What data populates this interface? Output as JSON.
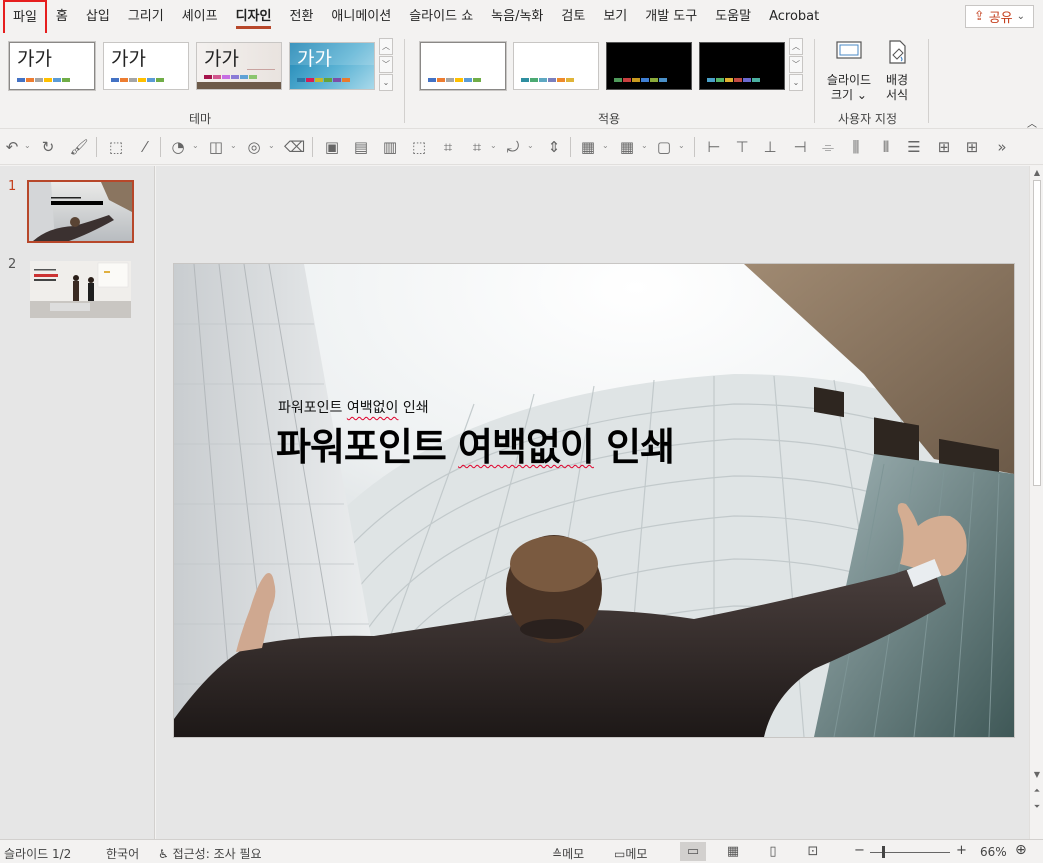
{
  "tabs": {
    "file": "파일",
    "home": "홈",
    "insert": "삽입",
    "draw": "그리기",
    "shape": "셰이프",
    "design": "디자인",
    "transitions": "전환",
    "animations": "애니메이션",
    "slideshow": "슬라이드 쇼",
    "record": "녹음/녹화",
    "review": "검토",
    "view": "보기",
    "developer": "개발 도구",
    "help": "도움말",
    "acrobat": "Acrobat"
  },
  "share": {
    "label": "공유"
  },
  "ribbon": {
    "themes": {
      "label": "테마",
      "items": [
        {
          "text": "가가",
          "colors": [
            "#4472c4",
            "#ed7d31",
            "#a5a5a5",
            "#ffc000",
            "#5b9bd5",
            "#70ad47"
          ]
        },
        {
          "text": "가가",
          "colors": [
            "#4472c4",
            "#ed7d31",
            "#a5a5a5",
            "#ffc000",
            "#5b9bd5",
            "#70ad47"
          ]
        },
        {
          "text": "가가",
          "colors": [
            "#a5134a",
            "#d2578e",
            "#c66ee3",
            "#8b7bd6",
            "#5fa2d6",
            "#8ac56e"
          ]
        },
        {
          "text": "가가",
          "colors": [
            "#2a78a6",
            "#d51e56",
            "#c7b72a",
            "#63a33c",
            "#7c4fa8",
            "#e97b2d"
          ]
        }
      ]
    },
    "variants": {
      "label": "적용",
      "items": [
        {
          "colors": [
            "#4472c4",
            "#ed7d31",
            "#a5a5a5",
            "#ffc000",
            "#5b9bd5",
            "#70ad47"
          ]
        },
        {
          "colors": [
            "#2f8fa0",
            "#4caa72",
            "#5ea8c2",
            "#7b7fbd",
            "#ee8a2b",
            "#e0b438"
          ]
        },
        {
          "colors": [
            "#4f9a5b",
            "#c84040",
            "#c89a20",
            "#3f7fd4",
            "#8aaa3a",
            "#4a90c8"
          ]
        },
        {
          "colors": [
            "#4aa0c8",
            "#55b46a",
            "#e0b030",
            "#c04a44",
            "#6a6ad0",
            "#4bb0a0"
          ]
        }
      ]
    },
    "customize": {
      "label": "사용자 지정",
      "slide_size": "슬라이드\n크기",
      "slide_size_line1": "슬라이드",
      "slide_size_line2": "크기",
      "bg_line1": "배경",
      "bg_line2": "서식"
    }
  },
  "slide": {
    "subtitle": "파워포인트 여백없이 인쇄",
    "subtitle_pre": "파워포인트 ",
    "subtitle_mark": "여백없이",
    "subtitle_post": " 인쇄",
    "title_pre": "파워포인트 ",
    "title_mark": "여백없이",
    "title_post": " 인쇄"
  },
  "thumbnails": [
    {
      "number": "1"
    },
    {
      "number": "2"
    }
  ],
  "status": {
    "slide_counter": "슬라이드 1/2",
    "language": "한국어",
    "accessibility": "접근성: 조사 필요",
    "notes": "메모",
    "comments": "메모",
    "zoom": "66%"
  }
}
